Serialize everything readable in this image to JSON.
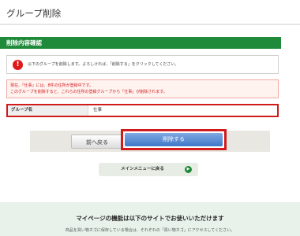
{
  "page": {
    "title": "グループ削除",
    "section_title": "削除内容確認"
  },
  "info": {
    "icon": "exclamation-circle-icon",
    "text": "以下のグループを削除します。よろしければ、「削除する」をクリックしてください。"
  },
  "warning": {
    "lines": [
      "現在、「仕事」には、8件の住所が登録中です。",
      "このグループを削除すると、これらの住所の登録グループから「仕事」が削除されます。"
    ]
  },
  "group": {
    "label": "グループ名",
    "value": "仕事"
  },
  "buttons": {
    "back": "前へ戻る",
    "delete": "削除する",
    "menu": "メインメニューに戻る"
  },
  "footer": {
    "title": "マイページの機能は以下のサイトでお使いいただけます",
    "note": "商品を買い物カゴに保存している場合は、それぞれの「買い物カゴ」にアクセスしてください。"
  },
  "colors": {
    "accent_green": "#1f8a3a",
    "highlight_red": "#d11a1a",
    "delete_blue": "#3f78c8"
  }
}
